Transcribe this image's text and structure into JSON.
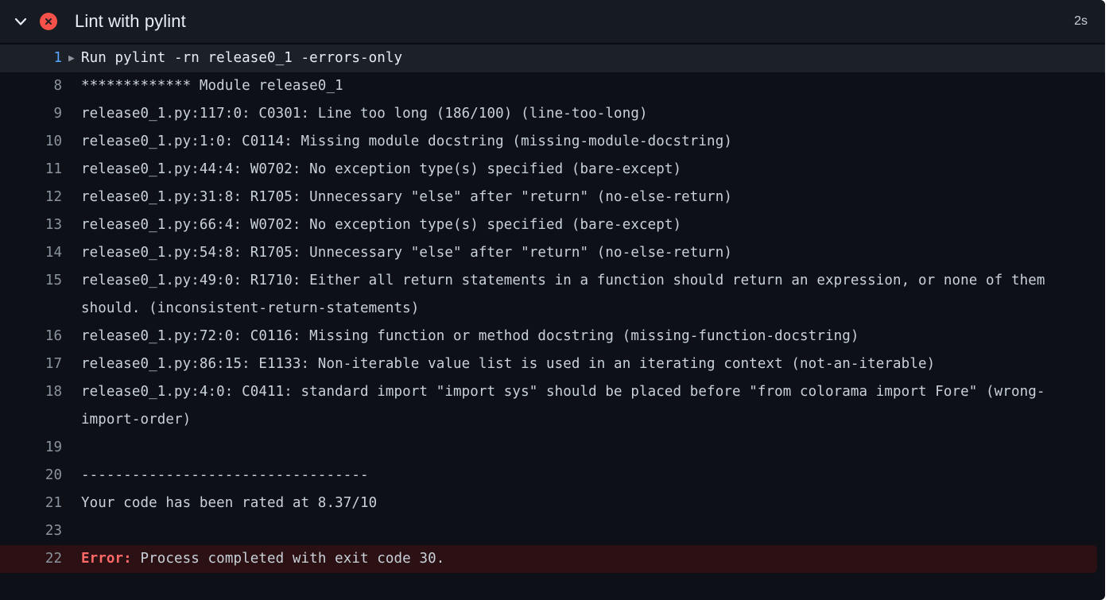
{
  "header": {
    "title": "Lint with pylint",
    "duration": "2s",
    "collapse_icon": "chevron-down-icon",
    "status_icon": "error-circle-x-icon",
    "status_color": "#f85149"
  },
  "colors": {
    "panel_background": "#0d1117",
    "header_background": "#161b22",
    "command_row_background": "#1c2128",
    "error_row_background": "#2b1114",
    "line_number": "#8b949e",
    "command_line_number": "#58a6ff",
    "text": "#c9d1d9",
    "error_text": "#ff6a69"
  },
  "log": {
    "rows": [
      {
        "number": "1",
        "kind": "command",
        "run_arrow": "▶",
        "text": "Run pylint -rn release0_1 -errors-only"
      },
      {
        "number": "8",
        "kind": "plain",
        "text": "************* Module release0_1"
      },
      {
        "number": "9",
        "kind": "plain",
        "text": "release0_1.py:117:0: C0301: Line too long (186/100) (line-too-long)"
      },
      {
        "number": "10",
        "kind": "plain",
        "text": "release0_1.py:1:0: C0114: Missing module docstring (missing-module-docstring)"
      },
      {
        "number": "11",
        "kind": "plain",
        "text": "release0_1.py:44:4: W0702: No exception type(s) specified (bare-except)"
      },
      {
        "number": "12",
        "kind": "plain",
        "text": "release0_1.py:31:8: R1705: Unnecessary \"else\" after \"return\" (no-else-return)"
      },
      {
        "number": "13",
        "kind": "plain",
        "text": "release0_1.py:66:4: W0702: No exception type(s) specified (bare-except)"
      },
      {
        "number": "14",
        "kind": "plain",
        "text": "release0_1.py:54:8: R1705: Unnecessary \"else\" after \"return\" (no-else-return)"
      },
      {
        "number": "15",
        "kind": "plain",
        "text": "release0_1.py:49:0: R1710: Either all return statements in a function should return an expression, or none of them should. (inconsistent-return-statements)"
      },
      {
        "number": "16",
        "kind": "plain",
        "text": "release0_1.py:72:0: C0116: Missing function or method docstring (missing-function-docstring)"
      },
      {
        "number": "17",
        "kind": "plain",
        "text": "release0_1.py:86:15: E1133: Non-iterable value list is used in an iterating context (not-an-iterable)"
      },
      {
        "number": "18",
        "kind": "plain",
        "text": "release0_1.py:4:0: C0411: standard import \"import sys\" should be placed before \"from colorama import Fore\" (wrong-import-order)"
      },
      {
        "number": "19",
        "kind": "plain",
        "text": ""
      },
      {
        "number": "20",
        "kind": "plain",
        "text": "----------------------------------"
      },
      {
        "number": "21",
        "kind": "plain",
        "text": "Your code has been rated at 8.37/10"
      },
      {
        "number": "23",
        "kind": "plain",
        "text": ""
      },
      {
        "number": "22",
        "kind": "error",
        "label": "Error:",
        "text": " Process completed with exit code 30."
      }
    ]
  }
}
